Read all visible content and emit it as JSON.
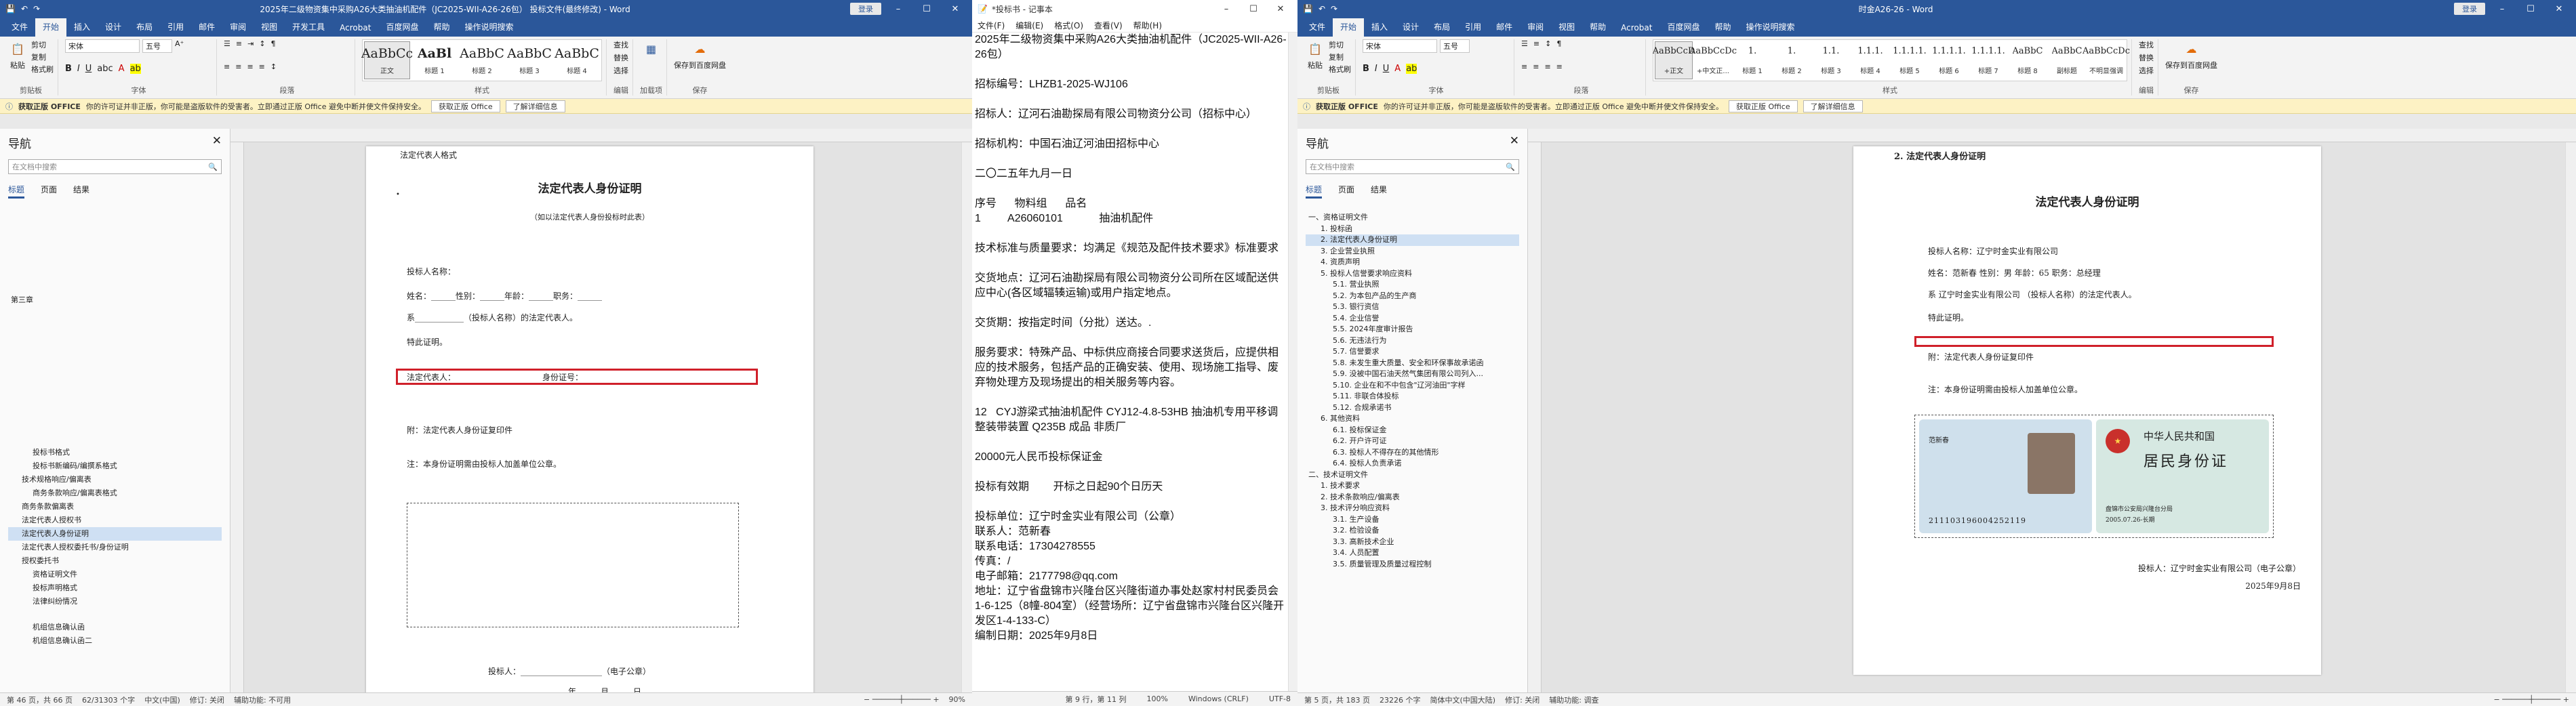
{
  "left_word": {
    "title": "2025年二级物资集中采购A26大类抽油机配件（JC2025-WII-A26-26包） 投标文件(最终修改) - Word",
    "signin": "登录",
    "menu": [
      "文件",
      "开始",
      "插入",
      "设计",
      "布局",
      "引用",
      "邮件",
      "审阅",
      "视图",
      "开发工具",
      "Acrobat",
      "百度网盘",
      "帮助",
      "操作说明搜索"
    ],
    "clipboard": {
      "paste": "粘贴",
      "cut": "剪切",
      "copy": "复制",
      "painter": "格式刷",
      "label": "剪贴板"
    },
    "font": {
      "name": "宋体",
      "size": "五号",
      "label": "字体"
    },
    "paragraph_label": "段落",
    "styles": [
      {
        "preview": "AaBbCc",
        "name": "正文"
      },
      {
        "preview": "AaBl",
        "name": "标题 1"
      },
      {
        "preview": "AaBbC",
        "name": "标题 2"
      },
      {
        "preview": "AaBbC",
        "name": "标题 3"
      },
      {
        "preview": "AaBbC",
        "name": "标题 4"
      }
    ],
    "styles_label": "样式",
    "editing": {
      "find": "查找",
      "replace": "替换",
      "select": "选择",
      "label": "编辑"
    },
    "addins": "加载项",
    "baidu": "保存到百度网盘",
    "save_label": "保存",
    "infobar": {
      "badge": "获取正版 OFFICE",
      "text": "你的许可证并非正版，你可能是盗版软件的受害者。立即通过正版 Office 避免中断并使文件保持安全。",
      "btn1": "获取正版 Office",
      "btn2": "了解详细信息"
    },
    "nav": {
      "title": "导航",
      "search": "在文档中搜索",
      "tabs": [
        "标题",
        "页面",
        "结果"
      ],
      "items": [
        "第三章",
        "投标书格式",
        "投标书新编码/编撰系格式",
        "技术规格响应/偏离表",
        "商务条款响应/偏离表格式",
        "商务条款偏离表",
        "法定代表人授权书",
        "法定代表人身份证明",
        "法定代表人授权委托书/身份证明",
        "授权委托书",
        "资格证明文件",
        "投标声明格式",
        "法律纠纷情况",
        "机组信息确认函",
        "机组信息确认函二"
      ]
    },
    "doc": {
      "top_label": "法定代表人格式",
      "title": "法定代表人身份证明",
      "subtitle": "（如以法定代表人身份投标时此表）",
      "bidder": "投标人名称：",
      "name_line": "姓名：______性别：______年龄：______职务：______",
      "is_line": "系____________（投标人名称）的法定代表人。",
      "special": "特此证明。",
      "legal": "法定代表人：",
      "idno": "身份证号：",
      "attach": "附：法定代表人身份证复印件",
      "note": "注：本身份证明需由投标人加盖单位公章。",
      "sign": "投标人：____________________（电子公章）",
      "date": "________年______月______日"
    },
    "status": {
      "page": "第 46 页，共 66 页",
      "words": "62/31303 个字",
      "lang": "中文(中国)",
      "track": "修订: 关闭",
      "access": "辅助功能: 不可用",
      "zoom": "90%"
    }
  },
  "notepad": {
    "title": "*投标书 - 记事本",
    "menu": [
      "文件(F)",
      "编辑(E)",
      "格式(O)",
      "查看(V)",
      "帮助(H)"
    ],
    "lines": [
      "2025年二级物资集中采购A26大类抽油机配件（JC2025-WII-A26-26包）",
      "",
      "招标编号：LHZB1-2025-WJ106",
      "",
      "招标人：辽河石油勘探局有限公司物资分公司（招标中心）",
      "",
      "招标机构：中国石油辽河油田招标中心",
      "",
      "二〇二五年九月一日",
      "",
      "序号      物料组      品名",
      "1         A26060101            抽油机配件",
      "",
      "技术标准与质量要求：均满足《规范及配件技术要求》标准要求",
      "",
      "交货地点：辽河石油勘探局有限公司物资分公司所在区域配送供应中心(各区域辐辏运输)或用户指定地点。",
      "",
      "交货期：按指定时间（分批）送达。.",
      "",
      "服务要求：特殊产品、中标供应商接合同要求送货后，应提供相应的技术服务，包括产品的正确安装、使用、现场施工指导、废弃物处理方及现场提出的相关服务等内容。",
      "",
      "12   CYJ游梁式抽油机配件 CYJ12-4.8-53HB 抽油机专用平移调整装带装置 Q235B 成品 非质厂",
      "",
      "20000元人民币投标保证金",
      "",
      "投标有效期        开标之日起90个日历天",
      "",
      "投标单位：辽宁时金实业有限公司（公章）",
      "联系人：范新春",
      "联系电话：17304278555",
      "传真：/",
      "电子邮箱：2177798@qq.com",
      "地址：辽宁省盘锦市兴隆台区兴隆街道办事处赵家村村民委员会1-6-125（8幢-804室）（经营场所：辽宁省盘锦市兴隆台区兴隆开发区1-4-133-C）",
      "编制日期：2025年9月8日"
    ],
    "status": {
      "pos": "第 9 行，第 11 列",
      "zoom": "100%",
      "eol": "Windows (CRLF)",
      "enc": "UTF-8"
    }
  },
  "right_word": {
    "title": "时金A26-26 - Word",
    "signin": "登录",
    "menu": [
      "文件",
      "开始",
      "插入",
      "设计",
      "布局",
      "引用",
      "邮件",
      "审阅",
      "视图",
      "帮助",
      "Acrobat",
      "百度网盘",
      "帮助",
      "操作说明搜索"
    ],
    "styles": [
      {
        "preview": "AaBbCcD",
        "name": "+正文"
      },
      {
        "preview": "AaBbCcDc",
        "name": "+中文正..."
      },
      {
        "preview": "1.",
        "name": "标题 1"
      },
      {
        "preview": "1.",
        "name": "标题 2"
      },
      {
        "preview": "1.1.",
        "name": "标题 3"
      },
      {
        "preview": "1.1.1.",
        "name": "标题 4"
      },
      {
        "preview": "1.1.1.1.",
        "name": "标题 5"
      },
      {
        "preview": "1.1.1.1.",
        "name": "标题 6"
      },
      {
        "preview": "1.1.1.1.",
        "name": "标题 7"
      },
      {
        "preview": "AaBbC",
        "name": "标题 8"
      },
      {
        "preview": "AaBbC",
        "name": "副标题"
      },
      {
        "preview": "AaBbCcDc",
        "name": "不明显强调"
      }
    ],
    "infobar": {
      "badge": "获取正版 OFFICE",
      "text": "你的许可证并非正版，你可能是盗版软件的受害者。立即通过正版 Office 避免中断并使文件保持安全。",
      "btn1": "获取正版 Office",
      "btn2": "了解详细信息"
    },
    "nav": {
      "title": "导航",
      "search": "在文档中搜索",
      "tabs": [
        "标题",
        "页面",
        "结果"
      ],
      "items": [
        "一、资格证明文件",
        "1. 投标函",
        "2. 法定代表人身份证明",
        "3. 企业营业执照",
        "4. 资质声明",
        "5. 投标人信誉要求响应资料",
        "5.1. 营业执照",
        "5.2. 为本包产品的生产商",
        "5.3. 银行资信",
        "5.4. 企业信誉",
        "5.5. 2024年度审计报告",
        "5.6. 无违法行为",
        "5.7. 信誉要求",
        "5.8. 未发生重大质量、安全和环保事故承诺函",
        "5.9. 没被中国石油天然气集团有限公司列入...",
        "5.10. 企业在和不中包含\"辽河油田\"字样",
        "5.11. 非联合体投标",
        "5.12. 合规承诺书",
        "6. 其他资料",
        "6.1. 投标保证金",
        "6.2. 开户许可证",
        "6.3. 投标人不得存在的其他情形",
        "6.4. 投标人负责承诺",
        "二、技术证明文件",
        "1. 技术要求",
        "2. 技术条款响应/偏离表",
        "3. 技术评分响应资料",
        "3.1. 生产设备",
        "3.2. 检验设备",
        "3.3. 高新技术企业",
        "3.4. 人员配置",
        "3.5. 质量管理及质量过程控制"
      ]
    },
    "doc": {
      "heading": "2. 法定代表人身份证明",
      "title": "法定代表人身份证明",
      "bidder": "投标人名称：辽宁时金实业有限公司",
      "name_line": "姓名：范新春   性别：男     年龄：65     职务：总经理",
      "is_line": "系 辽宁时金实业有限公司 （投标人名称）的法定代表人。",
      "special": "特此证明。",
      "attach": "附：法定代表人身份证复印件",
      "note": "注：本身份证明需由投标人加盖单位公章。",
      "sign": "投标人：辽宁时金实业有限公司（电子公章）",
      "date": "2025年9月8日",
      "id_name": "范新春",
      "id_no": "211103196004252119",
      "id_country": "中华人民共和国",
      "id_card": "居民身份证",
      "id_authority": "盘锦市公安局兴隆台分局",
      "id_valid": "2005.07.26-长期"
    },
    "status": {
      "page": "第 5 页，共 183 页",
      "words": "23226 个字",
      "lang": "简体中文(中国大陆)",
      "track": "修订: 关闭",
      "access": "辅助功能: 调查"
    }
  }
}
